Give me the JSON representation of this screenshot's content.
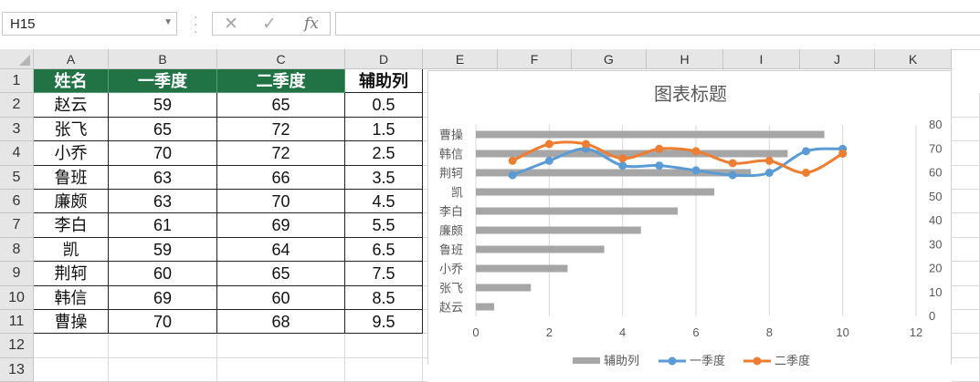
{
  "formula_bar": {
    "name_box": "H15",
    "cancel_glyph": "✕",
    "enter_glyph": "✓",
    "fx_label": "fx",
    "formula": ""
  },
  "columns": [
    "A",
    "B",
    "C",
    "D",
    "E",
    "F",
    "G",
    "H",
    "I",
    "J",
    "K"
  ],
  "rows": [
    "1",
    "2",
    "3",
    "4",
    "5",
    "6",
    "7",
    "8",
    "9",
    "10",
    "11",
    "12",
    "13"
  ],
  "table": {
    "headers": [
      "姓名",
      "一季度",
      "二季度",
      "辅助列"
    ],
    "rows": [
      [
        "赵云",
        "59",
        "65",
        "0.5"
      ],
      [
        "张飞",
        "65",
        "72",
        "1.5"
      ],
      [
        "小乔",
        "70",
        "72",
        "2.5"
      ],
      [
        "鲁班",
        "63",
        "66",
        "3.5"
      ],
      [
        "廉颇",
        "63",
        "70",
        "4.5"
      ],
      [
        "李白",
        "61",
        "69",
        "5.5"
      ],
      [
        "凯",
        "59",
        "64",
        "6.5"
      ],
      [
        "荆轲",
        "60",
        "65",
        "7.5"
      ],
      [
        "韩信",
        "69",
        "60",
        "8.5"
      ],
      [
        "曹操",
        "70",
        "68",
        "9.5"
      ]
    ]
  },
  "colors": {
    "header_fill": "#217346",
    "bar": "#a6a6a6",
    "series1": "#5b9bd5",
    "series2": "#ed7d31"
  },
  "chart_data": {
    "type": "bar",
    "title": "图表标题",
    "categories": [
      "赵云",
      "张飞",
      "小乔",
      "鲁班",
      "廉颇",
      "李白",
      "凯",
      "荆轲",
      "韩信",
      "曹操"
    ],
    "bar_series": {
      "name": "辅助列",
      "values": [
        0.5,
        1.5,
        2.5,
        3.5,
        4.5,
        5.5,
        6.5,
        7.5,
        8.5,
        9.5
      ]
    },
    "line_series": [
      {
        "name": "一季度",
        "x": [
          1,
          2,
          3,
          4,
          5,
          6,
          7,
          8,
          9,
          10
        ],
        "values": [
          59,
          65,
          70,
          63,
          63,
          61,
          59,
          60,
          69,
          70
        ]
      },
      {
        "name": "二季度",
        "x": [
          1,
          2,
          3,
          4,
          5,
          6,
          7,
          8,
          9,
          10
        ],
        "values": [
          65,
          72,
          72,
          66,
          70,
          69,
          64,
          65,
          60,
          68
        ]
      }
    ],
    "x_ticks": [
      "0",
      "2",
      "4",
      "6",
      "8",
      "10",
      "12"
    ],
    "xlim": [
      0,
      12
    ],
    "y2_ticks": [
      "0",
      "10",
      "20",
      "30",
      "40",
      "50",
      "60",
      "70",
      "80"
    ],
    "y2lim": [
      0,
      80
    ],
    "grid": "vertical",
    "legend": "bottom",
    "legend_items": [
      "辅助列",
      "一季度",
      "二季度"
    ]
  }
}
